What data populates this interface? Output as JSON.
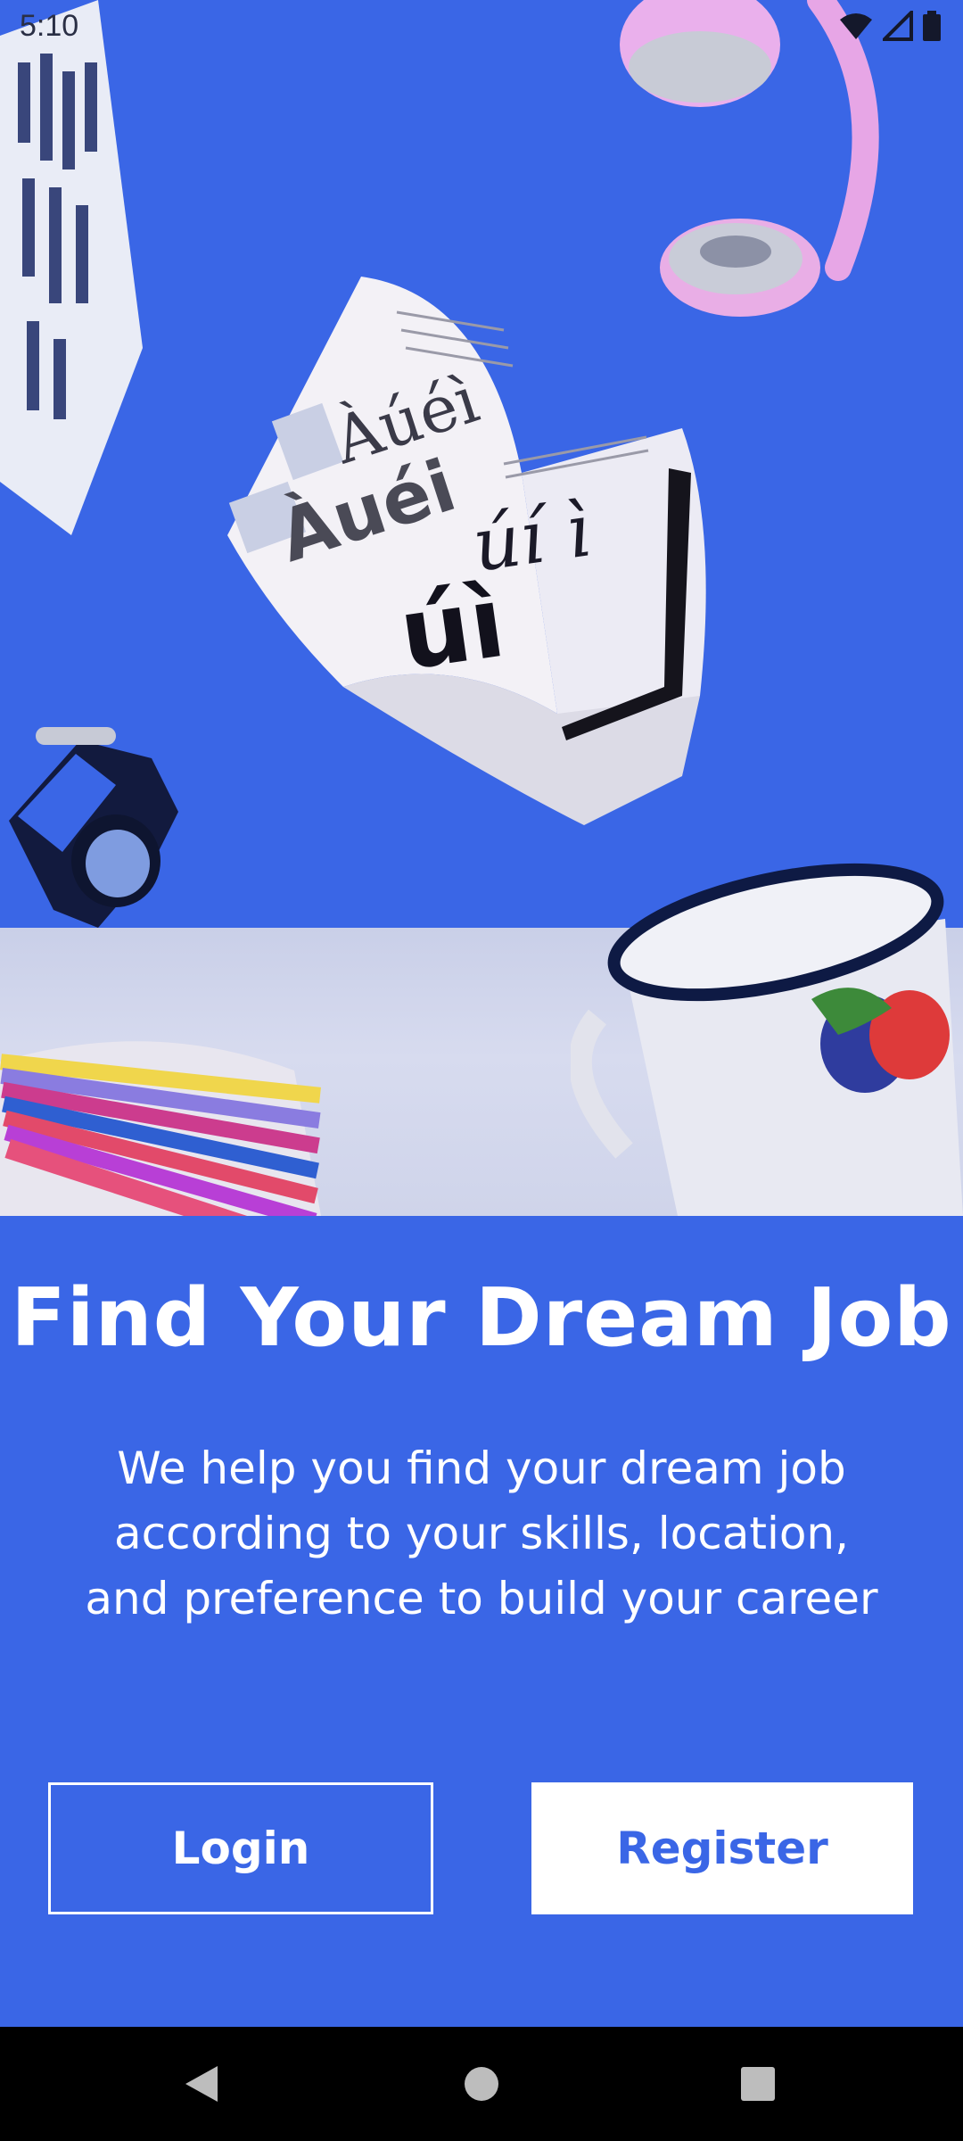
{
  "status_bar": {
    "time": "5:10"
  },
  "hero": {
    "book_text_a": "Àúéì",
    "book_text_b": "úí ì",
    "book_text_c": "úì"
  },
  "onboarding": {
    "title": "Find Your Dream Job",
    "subtitle": "We help you find your dream job according to your skills, location, and preference to build your career"
  },
  "actions": {
    "login_label": "Login",
    "register_label": "Register"
  },
  "colors": {
    "brand_blue": "#3a66e6",
    "white": "#ffffff",
    "nav_black": "#000000"
  }
}
